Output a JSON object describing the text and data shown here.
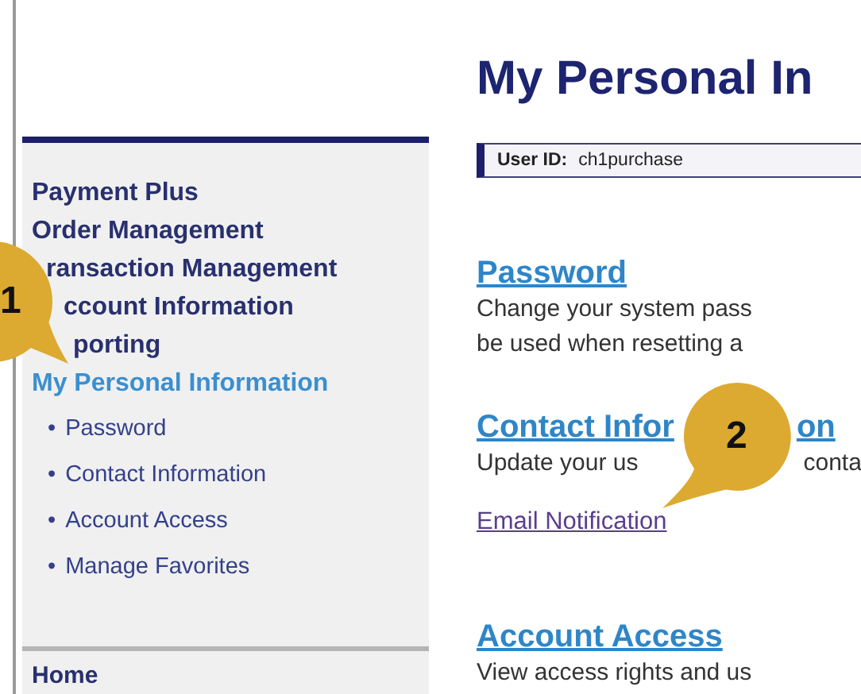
{
  "sidebar": {
    "items": [
      {
        "label": "Payment Plus",
        "kind": "full",
        "selected": false
      },
      {
        "label": "Order Management",
        "kind": "full",
        "selected": false
      },
      {
        "label": "ransaction Management",
        "kind": "partial",
        "selected": false
      },
      {
        "label": "ccount Information",
        "kind": "partialwide",
        "selected": false
      },
      {
        "label": "porting",
        "kind": "partialwide",
        "selected": false
      },
      {
        "label": "My Personal Information",
        "kind": "full",
        "selected": true
      }
    ],
    "subitems": [
      {
        "bullet": "•",
        "label": "Password"
      },
      {
        "bullet": "•",
        "label": "Contact Information"
      },
      {
        "bullet": "•",
        "label": "Account Access"
      },
      {
        "bullet": "•",
        "label": "Manage Favorites"
      }
    ],
    "footer": "Home"
  },
  "main": {
    "title": "My Personal In",
    "user_id": {
      "label": "User ID:",
      "value": "ch1purchase"
    },
    "sections": [
      {
        "heading": [
          "Password"
        ],
        "lines": [
          [
            "Change your system pass"
          ],
          [
            "be used when resetting a"
          ]
        ]
      },
      {
        "heading": [
          "Contact Infor",
          "on"
        ],
        "lines": [
          [
            "Update your us",
            "conta"
          ]
        ],
        "link": "Email Notification"
      },
      {
        "heading": [
          "Account Access"
        ],
        "lines": [
          [
            "View access rights and us"
          ]
        ]
      }
    ]
  },
  "callouts": [
    {
      "number": "1"
    },
    {
      "number": "2"
    }
  ]
}
